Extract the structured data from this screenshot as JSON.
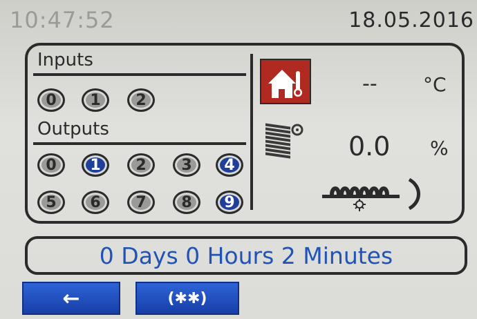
{
  "header": {
    "time": "10:47:52",
    "date": "18.05.2016"
  },
  "inputs": {
    "title": "Inputs",
    "items": [
      {
        "label": "0",
        "active": false
      },
      {
        "label": "1",
        "active": false
      },
      {
        "label": "2",
        "active": false
      }
    ]
  },
  "outputs": {
    "title": "Outputs",
    "items": [
      {
        "label": "0",
        "active": false
      },
      {
        "label": "1",
        "active": true
      },
      {
        "label": "2",
        "active": false
      },
      {
        "label": "3",
        "active": false
      },
      {
        "label": "4",
        "active": true
      },
      {
        "label": "5",
        "active": false
      },
      {
        "label": "6",
        "active": false
      },
      {
        "label": "7",
        "active": false
      },
      {
        "label": "8",
        "active": false
      },
      {
        "label": "9",
        "active": true
      }
    ]
  },
  "readings": {
    "temperature_value": "--",
    "temperature_unit": "°C",
    "shutter_value": "0.0",
    "shutter_unit": "%"
  },
  "icons": {
    "home_temp": "house-thermometer-icon",
    "shutter": "shutter-icon",
    "heater": "heater-rotation-icon"
  },
  "status": {
    "uptime": "0 Days 0 Hours 2 Minutes"
  },
  "buttons": {
    "back_label": "←",
    "action_label": "(✱✱)"
  },
  "colors": {
    "accent_blue": "#2052b8",
    "active_io": "#1f3f9a",
    "home_icon_bg": "#b12a22"
  }
}
